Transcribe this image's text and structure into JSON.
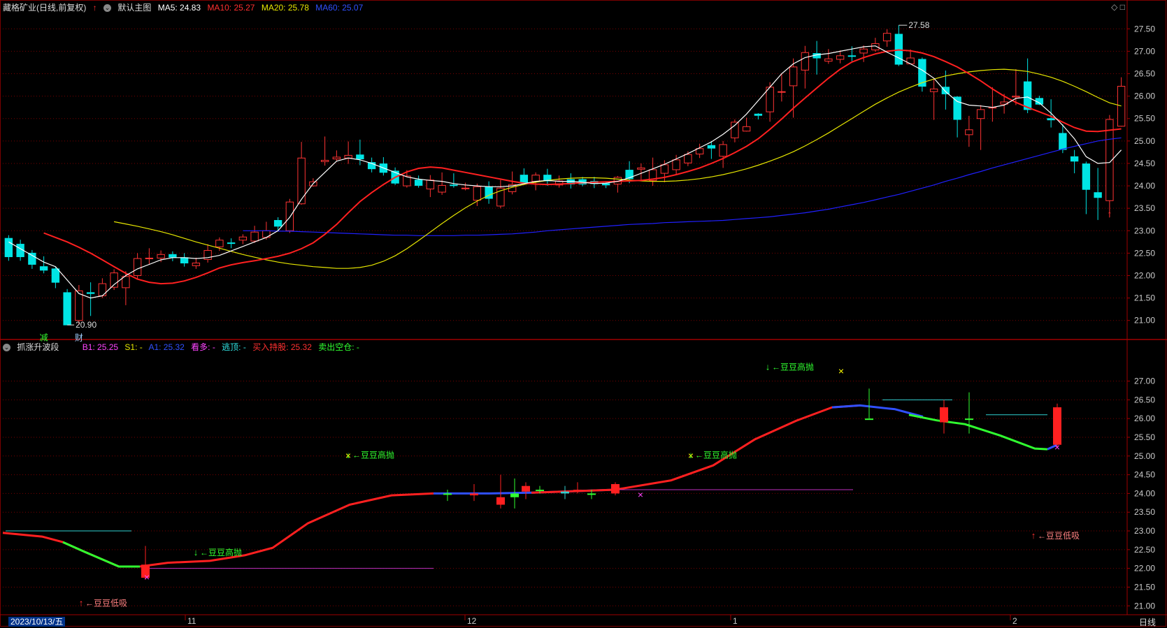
{
  "top_header": {
    "stock_name": "藏格矿业(日线,前复权)",
    "chart_mode": "默认主图",
    "ma5_label": "MA5: 24.83",
    "ma10_label": "MA10: 25.27",
    "ma20_label": "MA20: 25.78",
    "ma60_label": "MA60: 25.07"
  },
  "sub_header": {
    "indicator_name": "抓涨升波段",
    "b1": "B1: 25.25",
    "s1": "S1: -",
    "a1": "A1: 25.32",
    "kan_duo": "看多: -",
    "tao_ding": "逃顶: -",
    "buy_hold": "买入持股: 25.32",
    "sell_empty": "卖出空仓: -"
  },
  "top_axis_ticks": [
    "27.50",
    "27.00",
    "26.50",
    "26.00",
    "25.50",
    "25.00",
    "24.50",
    "24.00",
    "23.50",
    "23.00",
    "22.50",
    "22.00",
    "21.50",
    "21.00"
  ],
  "bottom_axis_ticks": [
    "27.00",
    "26.50",
    "26.00",
    "25.50",
    "25.00",
    "24.50",
    "24.00",
    "23.50",
    "23.00",
    "22.50",
    "22.00",
    "21.50",
    "21.00"
  ],
  "annotations": {
    "high_label": "27.58",
    "low_label": "20.90",
    "event_1": "减",
    "event_2": "财",
    "dou_high": "豆豆高抛",
    "dou_low": "豆豆低吸"
  },
  "time_axis": {
    "current_date": "2023/10/13/五",
    "month_labels": [
      "11",
      "12",
      "1",
      "2"
    ],
    "period": "日线"
  },
  "colors": {
    "up": "#ff3333",
    "down": "#00e5e5",
    "ma5": "#ffffff",
    "ma10": "#ff2020",
    "ma20": "#e6e600",
    "ma60": "#2020ff",
    "grid": "#7a0000",
    "axis_text": "#cccccc"
  },
  "chart_data": {
    "type": "candlestick",
    "ylim": [
      20.7,
      27.8
    ],
    "candles": [
      [
        22.83,
        22.42,
        22.9,
        22.33
      ],
      [
        22.7,
        22.42,
        22.8,
        22.33
      ],
      [
        22.5,
        22.25,
        22.57,
        22.15
      ],
      [
        22.2,
        22.12,
        22.43,
        22.05
      ],
      [
        22.15,
        21.85,
        22.2,
        21.72
      ],
      [
        21.62,
        20.9,
        21.7,
        20.9
      ],
      [
        21.0,
        21.66,
        21.79,
        20.9
      ],
      [
        21.62,
        21.6,
        21.85,
        21.1
      ],
      [
        21.55,
        21.82,
        21.94,
        21.5
      ],
      [
        21.74,
        22.06,
        22.14,
        21.68
      ],
      [
        21.73,
        21.98,
        22.1,
        21.34
      ],
      [
        22.0,
        22.38,
        22.5,
        21.91
      ],
      [
        22.38,
        22.39,
        22.61,
        22.25
      ],
      [
        22.39,
        22.47,
        22.56,
        22.3
      ],
      [
        22.47,
        22.41,
        22.54,
        22.32
      ],
      [
        22.4,
        22.28,
        22.5,
        22.2
      ],
      [
        22.22,
        22.28,
        22.4,
        22.15
      ],
      [
        22.36,
        22.56,
        22.7,
        22.29
      ],
      [
        22.64,
        22.79,
        22.85,
        22.55
      ],
      [
        22.73,
        22.72,
        22.83,
        22.61
      ],
      [
        22.79,
        22.86,
        22.92,
        22.7
      ],
      [
        22.77,
        22.97,
        23.11,
        22.73
      ],
      [
        22.85,
        23.0,
        23.2,
        22.8
      ],
      [
        23.23,
        23.1,
        23.3,
        23.0
      ],
      [
        23.0,
        23.64,
        23.71,
        22.95
      ],
      [
        23.6,
        24.62,
        24.98,
        23.58
      ],
      [
        24.0,
        24.09,
        24.17,
        23.98
      ],
      [
        24.54,
        24.57,
        25.1,
        24.45
      ],
      [
        24.6,
        24.64,
        24.79,
        24.55
      ],
      [
        24.62,
        24.68,
        24.99,
        24.49
      ],
      [
        24.69,
        24.6,
        25.03,
        24.46
      ],
      [
        24.52,
        24.38,
        24.63,
        24.3
      ],
      [
        24.49,
        24.3,
        24.64,
        24.23
      ],
      [
        24.33,
        24.06,
        24.41,
        24.02
      ],
      [
        24.0,
        24.22,
        24.35,
        23.96
      ],
      [
        24.13,
        24.01,
        24.23,
        23.96
      ],
      [
        23.93,
        24.13,
        24.24,
        23.75
      ],
      [
        23.86,
        24.01,
        24.3,
        23.8
      ],
      [
        24.02,
        24.01,
        24.28,
        23.96
      ],
      [
        23.95,
        23.95,
        24.07,
        23.9
      ],
      [
        23.68,
        23.98,
        24.05,
        23.55
      ],
      [
        23.98,
        23.72,
        24.1,
        23.6
      ],
      [
        23.55,
        23.95,
        24.13,
        23.5
      ],
      [
        23.87,
        24.03,
        24.32,
        23.81
      ],
      [
        24.24,
        24.07,
        24.39,
        24.07
      ],
      [
        24.1,
        24.24,
        24.3,
        23.9
      ],
      [
        24.24,
        24.11,
        24.38,
        24.0
      ],
      [
        24.02,
        24.11,
        24.23,
        23.96
      ],
      [
        24.14,
        24.04,
        24.28,
        23.94
      ],
      [
        24.14,
        24.04,
        24.2,
        23.99
      ],
      [
        24.1,
        24.05,
        24.2,
        23.95
      ],
      [
        24.05,
        24.02,
        24.1,
        23.95
      ],
      [
        24.04,
        24.19,
        24.22,
        23.85
      ],
      [
        24.35,
        24.16,
        24.55,
        24.06
      ],
      [
        24.37,
        24.4,
        24.5,
        24.12
      ],
      [
        24.12,
        24.36,
        24.63,
        24.0
      ],
      [
        24.28,
        24.47,
        24.57,
        24.08
      ],
      [
        24.36,
        24.58,
        24.69,
        24.25
      ],
      [
        24.51,
        24.7,
        24.77,
        24.44
      ],
      [
        24.71,
        24.83,
        24.94,
        24.62
      ],
      [
        24.9,
        24.84,
        25.0,
        24.6
      ],
      [
        24.66,
        24.92,
        25.0,
        24.4
      ],
      [
        25.07,
        25.42,
        25.48,
        24.97
      ],
      [
        25.22,
        25.32,
        25.52,
        25.21
      ],
      [
        25.6,
        25.57,
        25.62,
        25.48
      ],
      [
        25.65,
        26.2,
        26.31,
        25.43
      ],
      [
        26.09,
        26.1,
        26.5,
        25.88
      ],
      [
        26.23,
        26.65,
        26.84,
        25.52
      ],
      [
        26.58,
        26.97,
        27.12,
        26.17
      ],
      [
        26.95,
        26.85,
        27.23,
        26.48
      ],
      [
        26.78,
        26.83,
        27.05,
        26.72
      ],
      [
        26.82,
        26.9,
        27.02,
        26.73
      ],
      [
        26.9,
        26.89,
        27.11,
        26.78
      ],
      [
        26.96,
        27.05,
        27.13,
        26.76
      ],
      [
        27.03,
        27.17,
        27.3,
        26.99
      ],
      [
        27.23,
        27.4,
        27.49,
        27.1
      ],
      [
        27.38,
        26.71,
        27.58,
        26.67
      ],
      [
        26.72,
        26.85,
        27.04,
        26.71
      ],
      [
        26.82,
        26.22,
        26.86,
        26.1
      ],
      [
        26.1,
        26.16,
        26.38,
        25.47
      ],
      [
        26.2,
        26.05,
        26.57,
        25.7
      ],
      [
        25.98,
        25.48,
        26.0,
        25.08
      ],
      [
        25.14,
        25.25,
        25.56,
        24.87
      ],
      [
        25.5,
        25.7,
        25.8,
        24.8
      ],
      [
        25.74,
        25.75,
        26.2,
        25.43
      ],
      [
        25.82,
        25.87,
        26.05,
        25.61
      ],
      [
        25.98,
        26.0,
        26.6,
        25.8
      ],
      [
        26.32,
        25.7,
        26.84,
        25.62
      ],
      [
        25.95,
        25.82,
        26.01,
        25.8
      ],
      [
        25.5,
        25.47,
        25.93,
        25.3
      ],
      [
        25.17,
        24.81,
        25.37,
        24.73
      ],
      [
        24.65,
        24.55,
        24.8,
        24.28
      ],
      [
        24.49,
        23.92,
        24.54,
        23.37
      ],
      [
        23.85,
        23.74,
        24.4,
        23.24
      ],
      [
        23.67,
        25.48,
        25.58,
        23.3
      ],
      [
        25.33,
        26.22,
        26.42,
        25.32
      ]
    ],
    "ma5": [
      22.75,
      22.6,
      22.45,
      22.3,
      22.2,
      21.9,
      21.6,
      21.5,
      21.55,
      21.8,
      22.0,
      22.15,
      22.25,
      22.35,
      22.4,
      22.4,
      22.38,
      22.4,
      22.45,
      22.55,
      22.65,
      22.75,
      22.85,
      23.0,
      23.3,
      23.7,
      24.05,
      24.3,
      24.55,
      24.62,
      24.58,
      24.5,
      24.4,
      24.3,
      24.2,
      24.15,
      24.12,
      24.1,
      24.05,
      24.02,
      24.0,
      23.98,
      23.98,
      24.0,
      24.05,
      24.1,
      24.12,
      24.1,
      24.1,
      24.08,
      24.05,
      24.06,
      24.1,
      24.18,
      24.28,
      24.38,
      24.48,
      24.6,
      24.72,
      24.85,
      24.98,
      25.15,
      25.35,
      25.6,
      25.9,
      26.2,
      26.5,
      26.72,
      26.86,
      26.92,
      26.95,
      27.0,
      27.05,
      27.1,
      27.12,
      26.98,
      26.85,
      26.72,
      26.58,
      26.4,
      26.1,
      25.88,
      25.8,
      25.78,
      25.75,
      25.8,
      25.95,
      25.98,
      25.85,
      25.62,
      25.35,
      25.05,
      24.65,
      24.5,
      24.52,
      24.8
    ],
    "ma10": [
      22.95,
      22.85,
      22.75,
      22.63,
      22.5,
      22.35,
      22.2,
      22.05,
      21.92,
      21.85,
      21.82,
      21.83,
      21.88,
      21.96,
      22.06,
      22.17,
      22.24,
      22.29,
      22.33,
      22.38,
      22.43,
      22.5,
      22.6,
      22.73,
      22.92,
      23.14,
      23.4,
      23.65,
      23.85,
      24.03,
      24.19,
      24.31,
      24.39,
      24.42,
      24.4,
      24.35,
      24.3,
      24.25,
      24.2,
      24.15,
      24.1,
      24.06,
      24.04,
      24.03,
      24.04,
      24.05,
      24.07,
      24.08,
      24.09,
      24.1,
      24.11,
      24.12,
      24.15,
      24.19,
      24.25,
      24.32,
      24.4,
      24.5,
      24.61,
      24.74,
      24.88,
      25.05,
      25.26,
      25.49,
      25.73,
      25.96,
      26.18,
      26.4,
      26.6,
      26.76,
      26.86,
      26.94,
      27.0,
      27.03,
      27.01,
      26.96,
      26.88,
      26.77,
      26.65,
      26.5,
      26.34,
      26.16,
      26.0,
      25.86,
      25.75,
      25.65,
      25.55,
      25.42,
      25.3,
      25.22,
      25.21,
      25.24,
      25.27
    ],
    "ma20": [
      23.2,
      23.15,
      23.1,
      23.04,
      22.98,
      22.91,
      22.83,
      22.75,
      22.68,
      22.61,
      22.54,
      22.47,
      22.41,
      22.35,
      22.3,
      22.26,
      22.23,
      22.2,
      22.18,
      22.16,
      22.16,
      22.18,
      22.23,
      22.32,
      22.44,
      22.6,
      22.78,
      22.97,
      23.16,
      23.34,
      23.51,
      23.66,
      23.79,
      23.89,
      23.97,
      24.03,
      24.08,
      24.12,
      24.15,
      24.17,
      24.18,
      24.18,
      24.17,
      24.15,
      24.13,
      24.11,
      24.1,
      24.1,
      24.11,
      24.13,
      24.16,
      24.2,
      24.25,
      24.31,
      24.38,
      24.46,
      24.55,
      24.65,
      24.76,
      24.89,
      25.03,
      25.18,
      25.34,
      25.5,
      25.66,
      25.82,
      25.96,
      26.09,
      26.2,
      26.3,
      26.38,
      26.45,
      26.5,
      26.54,
      26.57,
      26.59,
      26.6,
      26.58,
      26.55,
      26.49,
      26.42,
      26.33,
      26.22,
      26.1,
      25.97,
      25.85,
      25.78
    ],
    "ma60": [
      23.0,
      23.0,
      23.0,
      22.99,
      22.99,
      22.98,
      22.97,
      22.96,
      22.95,
      22.94,
      22.93,
      22.92,
      22.91,
      22.9,
      22.9,
      22.89,
      22.89,
      22.89,
      22.89,
      22.9,
      22.9,
      22.91,
      22.92,
      22.93,
      22.95,
      22.97,
      23.0,
      23.02,
      23.04,
      23.06,
      23.08,
      23.1,
      23.12,
      23.14,
      23.15,
      23.16,
      23.18,
      23.19,
      23.2,
      23.21,
      23.22,
      23.23,
      23.25,
      23.27,
      23.29,
      23.31,
      23.34,
      23.37,
      23.4,
      23.44,
      23.48,
      23.53,
      23.58,
      23.63,
      23.69,
      23.75,
      23.81,
      23.88,
      23.95,
      24.02,
      24.1,
      24.17,
      24.25,
      24.32,
      24.4,
      24.47,
      24.54,
      24.61,
      24.68,
      24.75,
      24.82,
      24.88,
      24.94,
      25.0,
      25.04,
      25.07
    ]
  }
}
